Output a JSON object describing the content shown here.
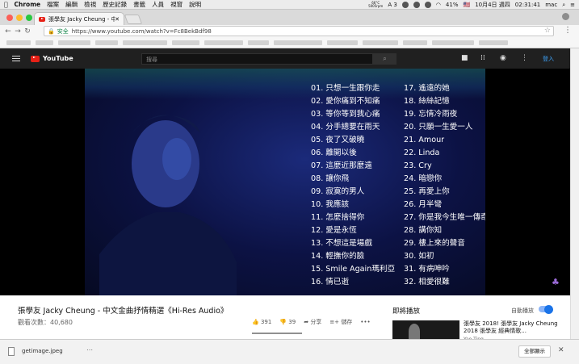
{
  "menubar": {
    "app": "Chrome",
    "items": [
      "檔案",
      "編輯",
      "檢視",
      "歷史記錄",
      "書籤",
      "人員",
      "視窗",
      "說明"
    ],
    "status_temp": "66°C",
    "status_net": "5005rpm",
    "a3": "A 3",
    "battery": "41%",
    "flag": "🇺🇸",
    "date": "10月4日 週四",
    "time": "02:31:41",
    "user": "mac"
  },
  "tab": {
    "title": "張學友 Jacky Cheung - 中文"
  },
  "toolbar": {
    "secure": "安全",
    "url": "https://www.youtube.com/watch?v=Fc8BekBdf98"
  },
  "yt": {
    "logo": "YouTube",
    "search_placeholder": "搜尋",
    "login": "登入"
  },
  "video": {
    "tracks_left": [
      "01. 只想一生跟你走",
      "02. 愛你痛到不知痛",
      "03. 等你等到我心痛",
      "04. 分手總要在雨天",
      "05. 夜了又破曉",
      "06. 離開以後",
      "07. 這麼近那麼遠",
      "08. 讓你飛",
      "09. 寂寞的男人",
      "10. 我應該",
      "11. 怎麼捨得你",
      "12. 愛是永恆",
      "13. 不想這是場戲",
      "14. 輕撫你的臉",
      "15. Smile Again瑪利亞",
      "16. 情已逝"
    ],
    "tracks_right": [
      "17. 遙遠的她",
      "18. 絲絲記憶",
      "19. 忘情冷雨夜",
      "20. 只願一生愛一人",
      "21. Amour",
      "22. Linda",
      "23. Cry",
      "24. 暗戀你",
      "25. 再愛上你",
      "26. 月半彎",
      "27. 你是我今生唯一傳奇",
      "28. 講你知",
      "29. 樓上來的聲音",
      "30. 如初",
      "31. 有病呻吟",
      "32. 相愛很難"
    ]
  },
  "info": {
    "title": "張學友 Jacky Cheung - 中文金曲抒情精選《Hi-Res Audio》",
    "views": "觀看次數：40,680",
    "likes": "391",
    "dislikes": "39",
    "share": "分享",
    "save": "儲存",
    "more": "•••"
  },
  "upnext": {
    "label": "即將播放",
    "autoplay": "自動播放",
    "title": "張學友 2018! 張學友 Jacky Cheung 2018 張學友 經典情歌...",
    "channel": "Yao Ting"
  },
  "download": {
    "file": "getimage.jpeg",
    "more": "⋯",
    "show_all": "全部顯示",
    "close": "✕"
  }
}
